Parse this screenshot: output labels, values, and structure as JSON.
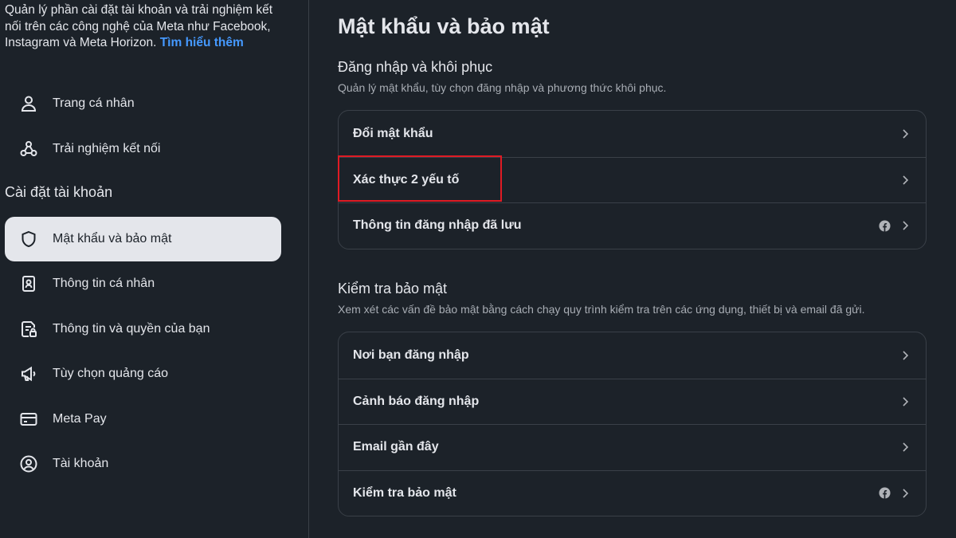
{
  "sidebar": {
    "intro": {
      "text": "Quản lý phần cài đặt tài khoản và trải nghiệm kết nối trên các công nghệ của Meta như Facebook, Instagram và Meta Horizon.",
      "link": "Tìm hiểu thêm"
    },
    "top_items": [
      {
        "label": "Trang cá nhân",
        "icon": "person-icon"
      },
      {
        "label": "Trải nghiệm kết nối",
        "icon": "connected-nodes-icon"
      }
    ],
    "section_title": "Cài đặt tài khoản",
    "items": [
      {
        "label": "Mật khẩu và bảo mật",
        "icon": "shield-icon",
        "active": true
      },
      {
        "label": "Thông tin cá nhân",
        "icon": "id-card-icon"
      },
      {
        "label": "Thông tin và quyền của bạn",
        "icon": "document-lock-icon"
      },
      {
        "label": "Tùy chọn quảng cáo",
        "icon": "megaphone-icon"
      },
      {
        "label": "Meta Pay",
        "icon": "credit-card-icon"
      },
      {
        "label": "Tài khoản",
        "icon": "account-circle-icon"
      }
    ]
  },
  "main": {
    "title": "Mật khẩu và bảo mật",
    "login_recovery": {
      "title": "Đăng nhập và khôi phục",
      "description": "Quản lý mật khẩu, tùy chọn đăng nhập và phương thức khôi phục.",
      "rows": [
        {
          "label": "Đổi mật khẩu",
          "fb_icon": false
        },
        {
          "label": "Xác thực 2 yếu tố",
          "fb_icon": false,
          "highlighted": true
        },
        {
          "label": "Thông tin đăng nhập đã lưu",
          "fb_icon": true
        }
      ]
    },
    "security_checks": {
      "title": "Kiểm tra bảo mật",
      "description": "Xem xét các vấn đề bảo mật bằng cách chạy quy trình kiểm tra trên các ứng dụng, thiết bị và email đã gửi.",
      "rows": [
        {
          "label": "Nơi bạn đăng nhập",
          "fb_icon": false
        },
        {
          "label": "Cảnh báo đăng nhập",
          "fb_icon": false
        },
        {
          "label": "Email gần đây",
          "fb_icon": false
        },
        {
          "label": "Kiểm tra bảo mật",
          "fb_icon": true
        }
      ]
    }
  },
  "colors": {
    "background": "#1c2229",
    "active_item_bg": "#e4e6eb",
    "link": "#4599ff",
    "highlight_border": "#e01b24"
  }
}
